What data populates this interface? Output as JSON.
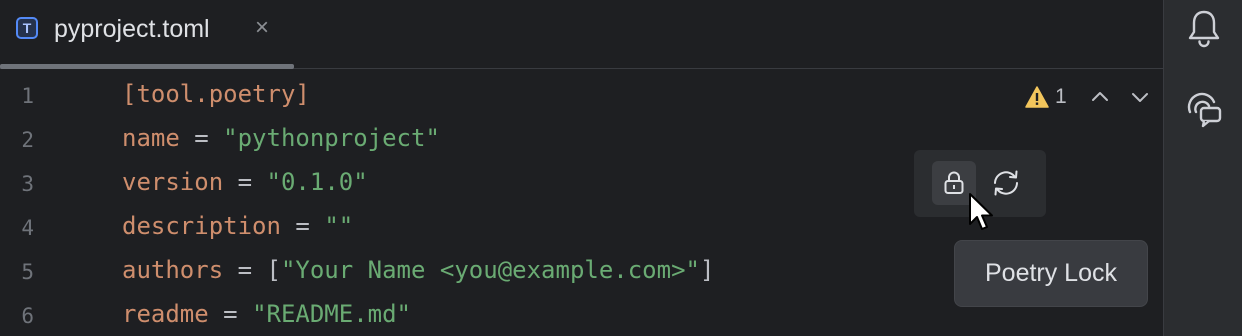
{
  "tab": {
    "filename": "pyproject.toml",
    "file_type_glyph": "T",
    "close_glyph": "×"
  },
  "lines": [
    {
      "n": "1",
      "parts": [
        {
          "t": "[tool.poetry]",
          "c": "key"
        }
      ]
    },
    {
      "n": "2",
      "parts": [
        {
          "t": "name",
          "c": "key"
        },
        {
          "t": " = ",
          "c": "punc"
        },
        {
          "t": "\"pythonproject\"",
          "c": "str"
        }
      ]
    },
    {
      "n": "3",
      "parts": [
        {
          "t": "version",
          "c": "key"
        },
        {
          "t": " = ",
          "c": "punc"
        },
        {
          "t": "\"0.1.0\"",
          "c": "str"
        }
      ]
    },
    {
      "n": "4",
      "parts": [
        {
          "t": "description",
          "c": "key"
        },
        {
          "t": " = ",
          "c": "punc"
        },
        {
          "t": "\"\"",
          "c": "str"
        }
      ]
    },
    {
      "n": "5",
      "parts": [
        {
          "t": "authors",
          "c": "key"
        },
        {
          "t": " = [",
          "c": "punc"
        },
        {
          "t": "\"Your Name <you@example.com>\"",
          "c": "str"
        },
        {
          "t": "]",
          "c": "punc"
        }
      ]
    },
    {
      "n": "6",
      "parts": [
        {
          "t": "readme",
          "c": "key"
        },
        {
          "t": " = ",
          "c": "punc"
        },
        {
          "t": "\"README.md\"",
          "c": "str"
        }
      ]
    }
  ],
  "inspections": {
    "warning_count": "1"
  },
  "tooltip": {
    "text": "Poetry Lock"
  },
  "icons": {
    "warning": "warning-icon",
    "up": "chevron-up-icon",
    "down": "chevron-down-icon",
    "lock": "lock-icon",
    "sync": "sync-icon",
    "bell": "bell-icon",
    "ai_assistant": "ai-assistant-icon"
  },
  "colors": {
    "background": "#1e1f22",
    "keyword": "#cf8e6d",
    "string": "#6aab73",
    "warning": "#f2c55c"
  }
}
